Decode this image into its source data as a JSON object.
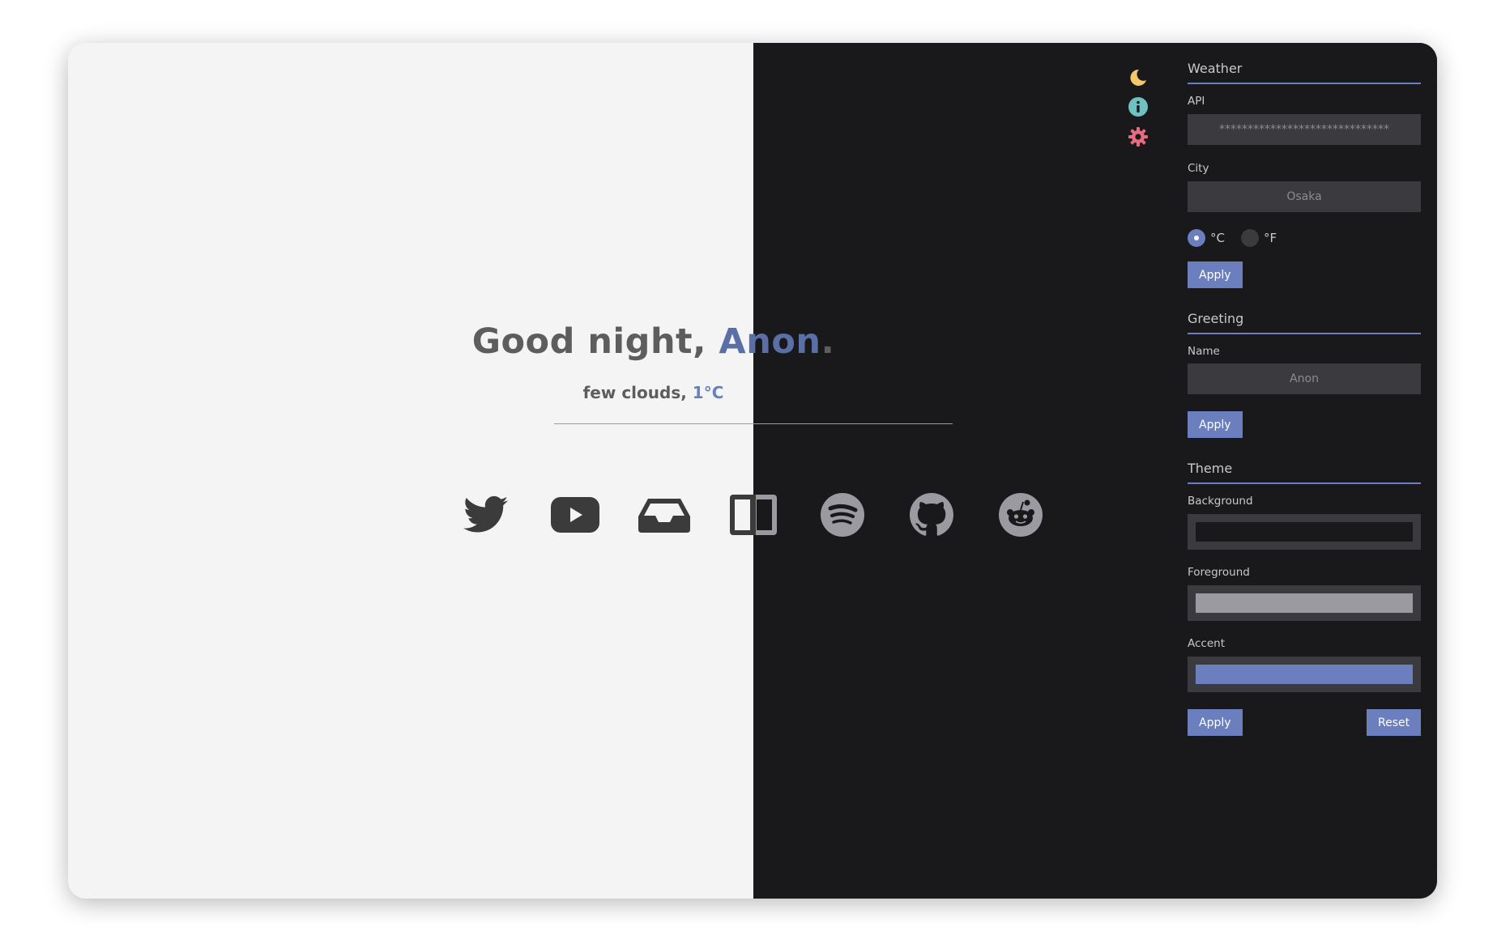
{
  "greeting": {
    "prefix": "Good night, ",
    "name": "Anon",
    "suffix": "."
  },
  "weather": {
    "description": "few clouds, ",
    "temperature": "1°C"
  },
  "links": [
    {
      "icon": "twitter-icon"
    },
    {
      "icon": "youtube-icon"
    },
    {
      "icon": "inbox-icon"
    },
    {
      "icon": "layout-icon"
    },
    {
      "icon": "spotify-icon"
    },
    {
      "icon": "github-icon"
    },
    {
      "icon": "reddit-icon"
    }
  ],
  "top_icons": [
    {
      "icon": "moon-icon",
      "color": "#f3c86b"
    },
    {
      "icon": "info-icon",
      "color": "#6fc0c0"
    },
    {
      "icon": "gear-icon",
      "color": "#e56b7e"
    }
  ],
  "settings": {
    "weather": {
      "title": "Weather",
      "api_label": "API",
      "api_value": "******************************",
      "city_label": "City",
      "city_value": "Osaka",
      "unit_celsius": "°C",
      "unit_fahrenheit": "°F",
      "selected_unit": "°C",
      "apply_label": "Apply"
    },
    "greeting": {
      "title": "Greeting",
      "name_label": "Name",
      "name_value": "Anon",
      "apply_label": "Apply"
    },
    "theme": {
      "title": "Theme",
      "background_label": "Background",
      "background_color": "#19191c",
      "foreground_label": "Foreground",
      "foreground_color": "#9a9aa0",
      "accent_label": "Accent",
      "accent_color": "#6b7fbe",
      "apply_label": "Apply",
      "reset_label": "Reset"
    }
  },
  "colors": {
    "light_background": "#f4f4f4",
    "dark_background": "#19191c",
    "accent": "#6b7fbe",
    "text": "#5d5d5d"
  }
}
